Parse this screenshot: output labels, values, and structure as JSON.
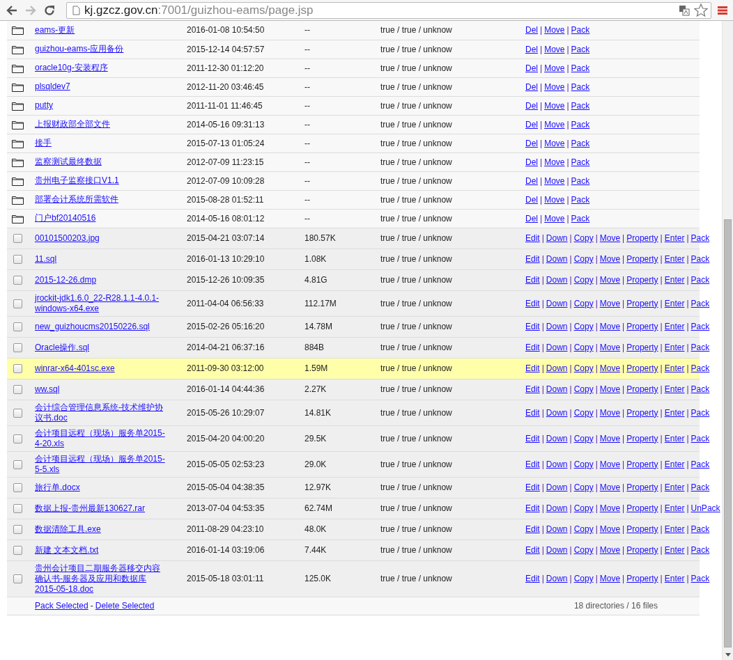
{
  "browser": {
    "back_enabled": true,
    "forward_enabled": false,
    "url_host": "kj.gzcz.gov.cn",
    "url_path": ":7001/guizhou-eams/page.jsp"
  },
  "rows": [
    {
      "kind": "folder",
      "name": "eams-更新",
      "time": "2016-01-08 10:54:50",
      "size": "--",
      "perms": "true / true / unknow",
      "highlighted": false,
      "actions": [
        "Del",
        "|",
        "Move",
        "|",
        "Pack"
      ]
    },
    {
      "kind": "folder",
      "name": "guizhou-eams-应用备份",
      "time": "2015-12-14 04:57:57",
      "size": "--",
      "perms": "true / true / unknow",
      "highlighted": false,
      "actions": [
        "Del",
        "|",
        "Move",
        "|",
        "Pack"
      ]
    },
    {
      "kind": "folder",
      "name": "oracle10g-安装程序",
      "time": "2011-12-30 01:12:20",
      "size": "--",
      "perms": "true / true / unknow",
      "highlighted": false,
      "actions": [
        "Del",
        "|",
        "Move",
        "|",
        "Pack"
      ]
    },
    {
      "kind": "folder",
      "name": "plsqldev7",
      "time": "2012-11-20 03:46:45",
      "size": "--",
      "perms": "true / true / unknow",
      "highlighted": false,
      "actions": [
        "Del",
        "|",
        "Move",
        "|",
        "Pack"
      ]
    },
    {
      "kind": "folder",
      "name": "putty",
      "time": "2011-11-01 11:46:45",
      "size": "--",
      "perms": "true / true / unknow",
      "highlighted": false,
      "actions": [
        "Del",
        "|",
        "Move",
        "|",
        "Pack"
      ]
    },
    {
      "kind": "folder",
      "name": "上报财政部全部文件",
      "time": "2014-05-16 09:31:13",
      "size": "--",
      "perms": "true / true / unknow",
      "highlighted": false,
      "actions": [
        "Del",
        "|",
        "Move",
        "|",
        "Pack"
      ]
    },
    {
      "kind": "folder",
      "name": "接手",
      "time": "2015-07-13 01:05:24",
      "size": "--",
      "perms": "true / true / unknow",
      "highlighted": false,
      "actions": [
        "Del",
        "|",
        "Move",
        "|",
        "Pack"
      ]
    },
    {
      "kind": "folder",
      "name": "监察测试最终数据",
      "time": "2012-07-09 11:23:15",
      "size": "--",
      "perms": "true / true / unknow",
      "highlighted": false,
      "actions": [
        "Del",
        "|",
        "Move",
        "|",
        "Pack"
      ]
    },
    {
      "kind": "folder",
      "name": "贵州电子监察接口V1.1",
      "time": "2012-07-09 10:09:28",
      "size": "--",
      "perms": "true / true / unknow",
      "highlighted": false,
      "actions": [
        "Del",
        "|",
        "Move",
        "|",
        "Pack"
      ]
    },
    {
      "kind": "folder",
      "name": "部署会计系统所需软件",
      "time": "2015-08-28 01:52:11",
      "size": "--",
      "perms": "true / true / unknow",
      "highlighted": false,
      "actions": [
        "Del",
        "|",
        "Move",
        "|",
        "Pack"
      ]
    },
    {
      "kind": "folder",
      "name": "门户bf20140516",
      "time": "2014-05-16 08:01:12",
      "size": "--",
      "perms": "true / true / unknow",
      "highlighted": false,
      "actions": [
        "Del",
        "|",
        "Move",
        "|",
        "Pack"
      ]
    },
    {
      "kind": "file",
      "checked": false,
      "name": "00101500203.jpg",
      "time": "2015-04-21 03:07:14",
      "size": "180.57K",
      "perms": "true / true / unknow",
      "highlighted": false,
      "actions": [
        "Edit",
        "|",
        "Down",
        "|",
        "Copy",
        "|",
        "Move",
        "|",
        "Property",
        "|",
        "Enter",
        "|",
        "Pack"
      ]
    },
    {
      "kind": "file",
      "checked": false,
      "name": "11.sql",
      "time": "2016-01-13 10:29:10",
      "size": "1.08K",
      "perms": "true / true / unknow",
      "highlighted": false,
      "actions": [
        "Edit",
        "|",
        "Down",
        "|",
        "Copy",
        "|",
        "Move",
        "|",
        "Property",
        "|",
        "Enter",
        "|",
        "Pack"
      ]
    },
    {
      "kind": "file",
      "checked": false,
      "name": "2015-12-26.dmp",
      "time": "2015-12-26 10:09:35",
      "size": "4.81G",
      "perms": "true / true / unknow",
      "highlighted": false,
      "actions": [
        "Edit",
        "|",
        "Down",
        "|",
        "Copy",
        "|",
        "Move",
        "|",
        "Property",
        "|",
        "Enter",
        "|",
        "Pack"
      ]
    },
    {
      "kind": "file",
      "checked": false,
      "name": "jrockit-jdk1.6.0_22-R28.1.1-4.0.1-windows-x64.exe",
      "time": "2011-04-04 06:56:33",
      "size": "112.17M",
      "perms": "true / true / unknow",
      "highlighted": false,
      "actions": [
        "Edit",
        "|",
        "Down",
        "|",
        "Copy",
        "|",
        "Move",
        "|",
        "Property",
        "|",
        "Enter",
        "|",
        "Pack"
      ]
    },
    {
      "kind": "file",
      "checked": false,
      "name": "new_guizhoucms20150226.sql",
      "time": "2015-02-26 05:16:20",
      "size": "14.78M",
      "perms": "true / true / unknow",
      "highlighted": false,
      "actions": [
        "Edit",
        "|",
        "Down",
        "|",
        "Copy",
        "|",
        "Move",
        "|",
        "Property",
        "|",
        "Enter",
        "|",
        "Pack"
      ]
    },
    {
      "kind": "file",
      "checked": false,
      "name": "Oracle操作.sql",
      "time": "2014-04-21 06:37:16",
      "size": "884B",
      "perms": "true / true / unknow",
      "highlighted": false,
      "actions": [
        "Edit",
        "|",
        "Down",
        "|",
        "Copy",
        "|",
        "Move",
        "|",
        "Property",
        "|",
        "Enter",
        "|",
        "Pack"
      ]
    },
    {
      "kind": "file",
      "checked": false,
      "name": "winrar-x64-401sc.exe",
      "time": "2011-09-30 03:12:00",
      "size": "1.59M",
      "perms": "true / true / unknow",
      "highlighted": true,
      "actions": [
        "Edit",
        "|",
        "Down",
        "|",
        "Copy",
        "|",
        "Move",
        "|",
        "Property",
        "|",
        "Enter",
        "|",
        "Pack"
      ]
    },
    {
      "kind": "file",
      "checked": false,
      "name": "ww.sql",
      "time": "2016-01-14 04:44:36",
      "size": "2.27K",
      "perms": "true / true / unknow",
      "highlighted": false,
      "actions": [
        "Edit",
        "|",
        "Down",
        "|",
        "Copy",
        "|",
        "Move",
        "|",
        "Property",
        "|",
        "Enter",
        "|",
        "Pack"
      ]
    },
    {
      "kind": "file",
      "checked": false,
      "name": "会计综合管理信息系统-技术维护协议书.doc",
      "time": "2015-05-26 10:29:07",
      "size": "14.81K",
      "perms": "true / true / unknow",
      "highlighted": false,
      "actions": [
        "Edit",
        "|",
        "Down",
        "|",
        "Copy",
        "|",
        "Move",
        "|",
        "Property",
        "|",
        "Enter",
        "|",
        "Pack"
      ]
    },
    {
      "kind": "file",
      "checked": false,
      "name": "会计项目远程（现场）服务单2015-4-20.xls",
      "time": "2015-04-20 04:00:20",
      "size": "29.5K",
      "perms": "true / true / unknow",
      "highlighted": false,
      "actions": [
        "Edit",
        "|",
        "Down",
        "|",
        "Copy",
        "|",
        "Move",
        "|",
        "Property",
        "|",
        "Enter",
        "|",
        "Pack"
      ]
    },
    {
      "kind": "file",
      "checked": false,
      "name": "会计项目远程（现场）服务单2015-5-5.xls",
      "time": "2015-05-05 02:53:23",
      "size": "29.0K",
      "perms": "true / true / unknow",
      "highlighted": false,
      "actions": [
        "Edit",
        "|",
        "Down",
        "|",
        "Copy",
        "|",
        "Move",
        "|",
        "Property",
        "|",
        "Enter",
        "|",
        "Pack"
      ]
    },
    {
      "kind": "file",
      "checked": false,
      "name": "旅行单.docx",
      "time": "2015-05-04 04:38:35",
      "size": "12.97K",
      "perms": "true / true / unknow",
      "highlighted": false,
      "actions": [
        "Edit",
        "|",
        "Down",
        "|",
        "Copy",
        "|",
        "Move",
        "|",
        "Property",
        "|",
        "Enter",
        "|",
        "Pack"
      ]
    },
    {
      "kind": "file",
      "checked": false,
      "name": "数据上报-贵州最新130627.rar",
      "time": "2013-07-04 04:53:35",
      "size": "62.74M",
      "perms": "true / true / unknow",
      "highlighted": false,
      "actions": [
        "Edit",
        "|",
        "Down",
        "|",
        "Copy",
        "|",
        "Move",
        "|",
        "Property",
        "|",
        "Enter",
        "|",
        "UnPack"
      ]
    },
    {
      "kind": "file",
      "checked": false,
      "name": "数据清除工具.exe",
      "time": "2011-08-29 04:23:10",
      "size": "48.0K",
      "perms": "true / true / unknow",
      "highlighted": false,
      "actions": [
        "Edit",
        "|",
        "Down",
        "|",
        "Copy",
        "|",
        "Move",
        "|",
        "Property",
        "|",
        "Enter",
        "|",
        "Pack"
      ]
    },
    {
      "kind": "file",
      "checked": false,
      "name": "新建 文本文档.txt",
      "time": "2016-01-14 03:19:06",
      "size": "7.44K",
      "perms": "true / true / unknow",
      "highlighted": false,
      "actions": [
        "Edit",
        "|",
        "Down",
        "|",
        "Copy",
        "|",
        "Move",
        "|",
        "Property",
        "|",
        "Enter",
        "|",
        "Pack"
      ]
    },
    {
      "kind": "file",
      "checked": false,
      "name": "贵州会计项目二期服务器移交内容确认书-服务器及应用和数据库2015-05-18.doc",
      "time": "2015-05-18 03:01:11",
      "size": "125.0K",
      "perms": "true / true / unknow",
      "highlighted": false,
      "actions": [
        "Edit",
        "|",
        "Down",
        "|",
        "Copy",
        "|",
        "Move",
        "|",
        "Property",
        "|",
        "Enter",
        "|",
        "Pack"
      ]
    }
  ],
  "footer": {
    "actions": [
      "Pack Selected",
      "-",
      "Delete Selected"
    ],
    "summary": "18 directories / 16 files"
  }
}
